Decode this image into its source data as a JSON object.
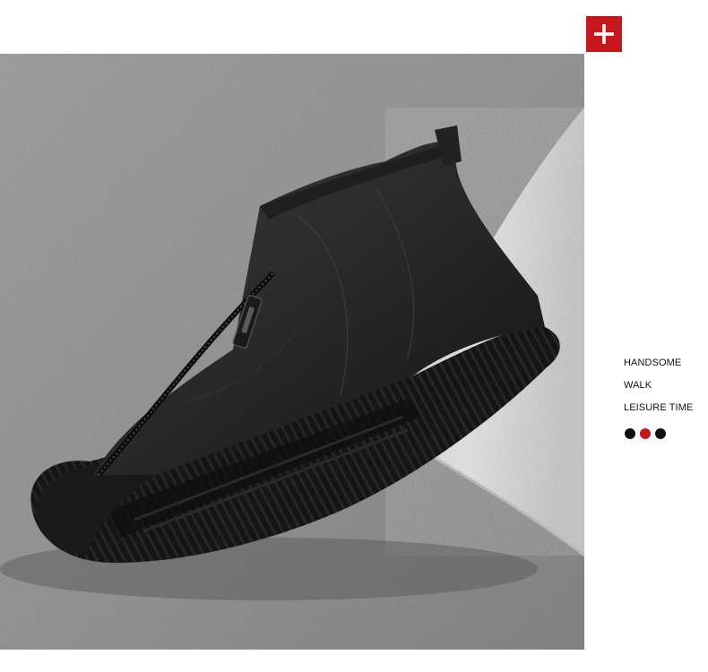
{
  "product": {
    "image_description": "Black leather high-top zip sneaker",
    "features": [
      "HANDSOME",
      "WALK",
      "LEISURE TIME"
    ]
  },
  "expand_button": {
    "icon": "plus-icon",
    "color": "#c8161d"
  },
  "color_options": [
    {
      "name": "black",
      "hex": "#111111"
    },
    {
      "name": "red",
      "hex": "#c8161d"
    },
    {
      "name": "black",
      "hex": "#111111"
    }
  ]
}
